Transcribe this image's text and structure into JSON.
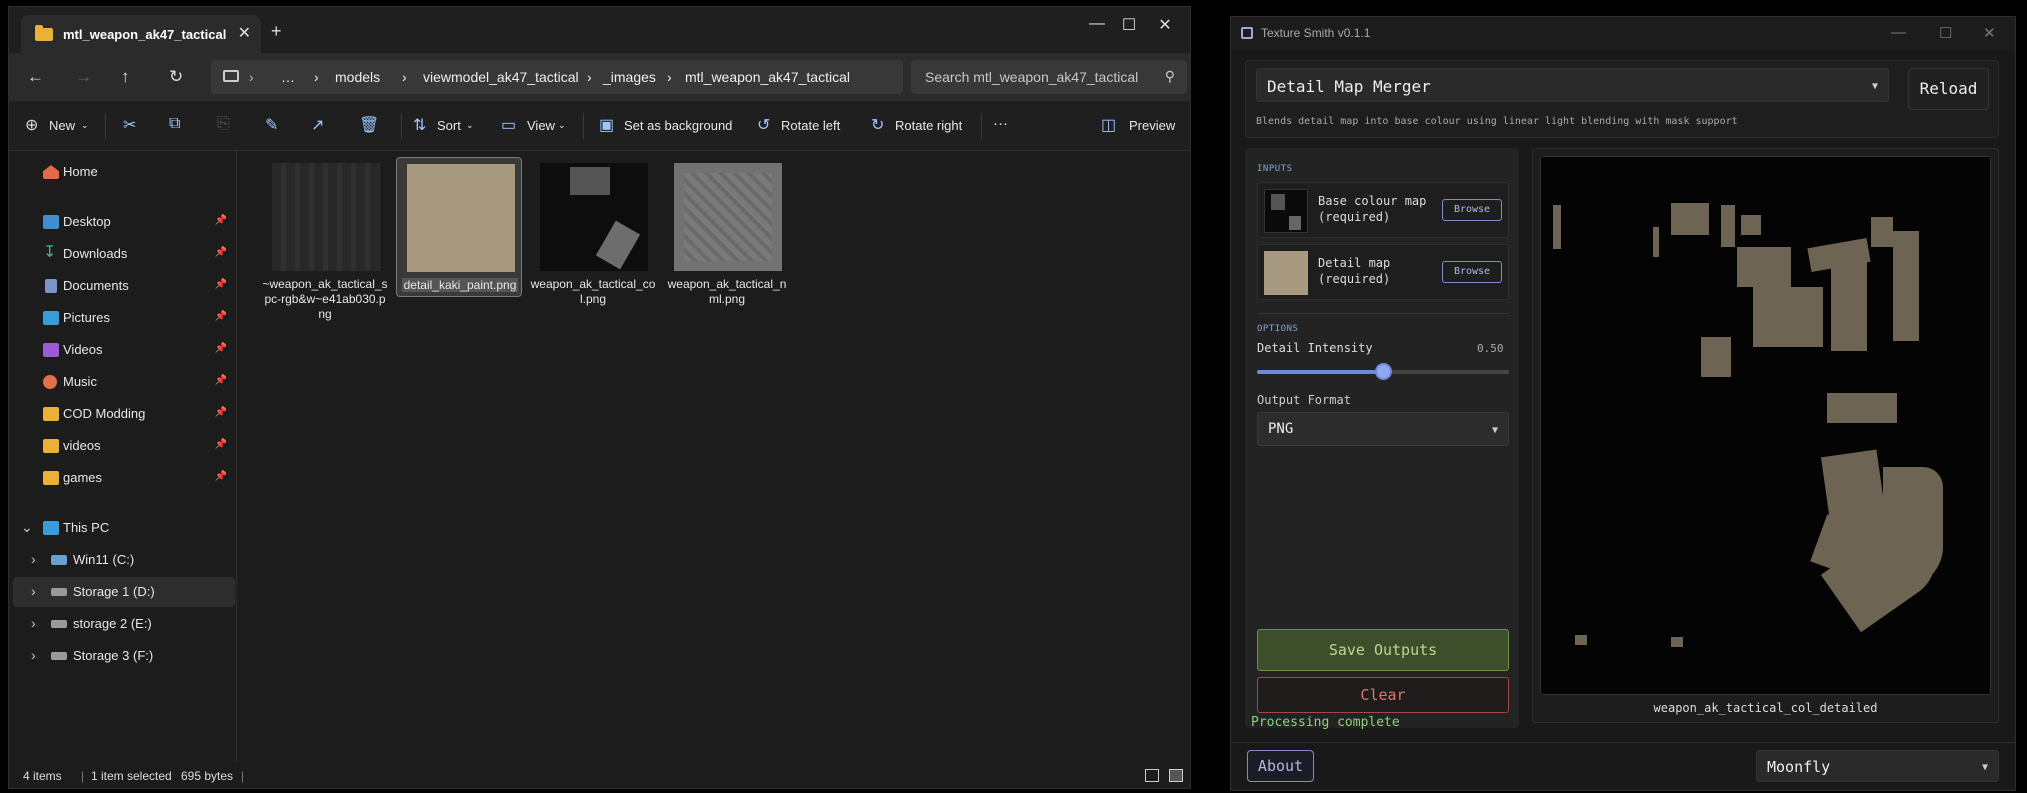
{
  "explorer": {
    "tab_title": "mtl_weapon_ak47_tactical",
    "tab_close": "✕",
    "new_tab": "+",
    "window_controls": [
      "—",
      "☐",
      "✕"
    ],
    "breadcrumb": [
      "…",
      "models",
      "viewmodel_ak47_tactical",
      "_images",
      "mtl_weapon_ak47_tactical"
    ],
    "search_placeholder": "Search mtl_weapon_ak47_tactical",
    "toolbar": {
      "new": "New",
      "sort": "Sort",
      "view": "View",
      "set_background": "Set as background",
      "rotate_left": "Rotate left",
      "rotate_right": "Rotate right",
      "more": "···",
      "preview": "Preview"
    },
    "sidebar": {
      "home": "Home",
      "quick_access": [
        "Desktop",
        "Downloads",
        "Documents",
        "Pictures",
        "Videos",
        "Music",
        "COD Modding",
        "videos",
        "games"
      ],
      "this_pc": "This PC",
      "drives": [
        "Win11 (C:)",
        "Storage 1 (D:)",
        "storage 2 (E:)",
        "Storage 3 (F:)"
      ]
    },
    "files": [
      {
        "name": "~weapon_ak_tactical_spc-rgb&w~e41ab030.png"
      },
      {
        "name": "detail_kaki_paint.png"
      },
      {
        "name": "weapon_ak_tactical_col.png"
      },
      {
        "name": "weapon_ak_tactical_nml.png"
      }
    ],
    "status": {
      "items": "4 items",
      "selected": "1 item selected",
      "size": "695 bytes"
    }
  },
  "texture_smith": {
    "title": "Texture Smith v0.1.1",
    "window_controls": [
      "—",
      "☐",
      "✕"
    ],
    "tool": "Detail Map Merger",
    "reload": "Reload",
    "description": "Blends detail map into base colour using linear light blending with mask support",
    "inputs_header": "INPUTS",
    "inputs": [
      {
        "label": "Base colour map\n(required)",
        "button": "Browse"
      },
      {
        "label": "Detail map\n(required)",
        "button": "Browse"
      }
    ],
    "options_header": "OPTIONS",
    "intensity_label": "Detail Intensity",
    "intensity_value_text": "0.50",
    "intensity_value": 0.5,
    "format_label": "Output Format",
    "format_value": "PNG",
    "save": "Save Outputs",
    "clear": "Clear",
    "preview_caption": "weapon_ak_tactical_col_detailed",
    "status": "Processing complete",
    "about": "About",
    "theme": "Moonfly"
  },
  "colors": {
    "folder": "#e8b238",
    "accent_blue": "#6e89d9",
    "save_green": "#b8d88c",
    "clear_red": "#e07373",
    "status_green": "#8dd178",
    "khaki": "#a89a80"
  }
}
